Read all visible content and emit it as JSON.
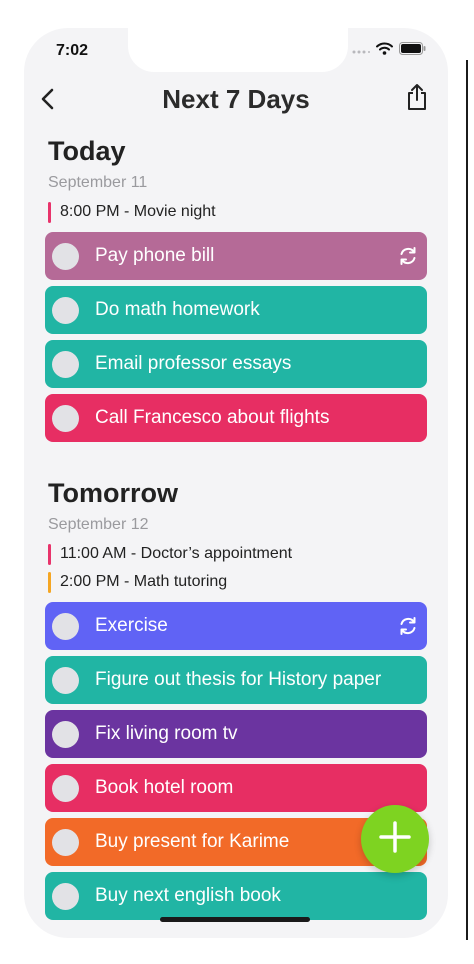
{
  "status_bar": {
    "time": "7:02",
    "icons": [
      "signal-dots-icon",
      "wifi-icon",
      "battery-icon"
    ]
  },
  "nav": {
    "title": "Next 7 Days",
    "back_icon": "chevron-left-icon",
    "share_icon": "share-icon"
  },
  "sections": [
    {
      "heading": "Today",
      "date": "September 11",
      "events": [
        {
          "time_title": "8:00 PM - Movie night",
          "color": "#e8336b"
        }
      ],
      "tasks": [
        {
          "label": "Pay phone bill",
          "color": "#b56a97",
          "repeat": true
        },
        {
          "label": "Do math homework",
          "color": "#21b5a4",
          "repeat": false
        },
        {
          "label": "Email professor essays",
          "color": "#21b5a4",
          "repeat": false
        },
        {
          "label": "Call Francesco about flights",
          "color": "#e72e63",
          "repeat": false
        }
      ]
    },
    {
      "heading": "Tomorrow",
      "date": "September 12",
      "events": [
        {
          "time_title": "11:00 AM - Doctor’s appointment",
          "color": "#e8336b"
        },
        {
          "time_title": "2:00 PM - Math tutoring",
          "color": "#f5a623"
        }
      ],
      "tasks": [
        {
          "label": "Exercise",
          "color": "#6063f5",
          "repeat": true
        },
        {
          "label": "Figure out thesis for History paper",
          "color": "#21b5a4",
          "repeat": false
        },
        {
          "label": "Fix living room tv",
          "color": "#6b34a0",
          "repeat": false
        },
        {
          "label": "Book hotel room",
          "color": "#e72e63",
          "repeat": false
        },
        {
          "label": "Buy present for Karime",
          "color": "#f26a28",
          "repeat": false
        },
        {
          "label": "Buy next english book",
          "color": "#21b5a4",
          "repeat": false
        }
      ]
    }
  ],
  "fab": {
    "icon": "plus-icon",
    "color": "#7ed321"
  },
  "colors": {
    "background": "#f4f4f6",
    "checkbox": "#e2e2e6"
  }
}
